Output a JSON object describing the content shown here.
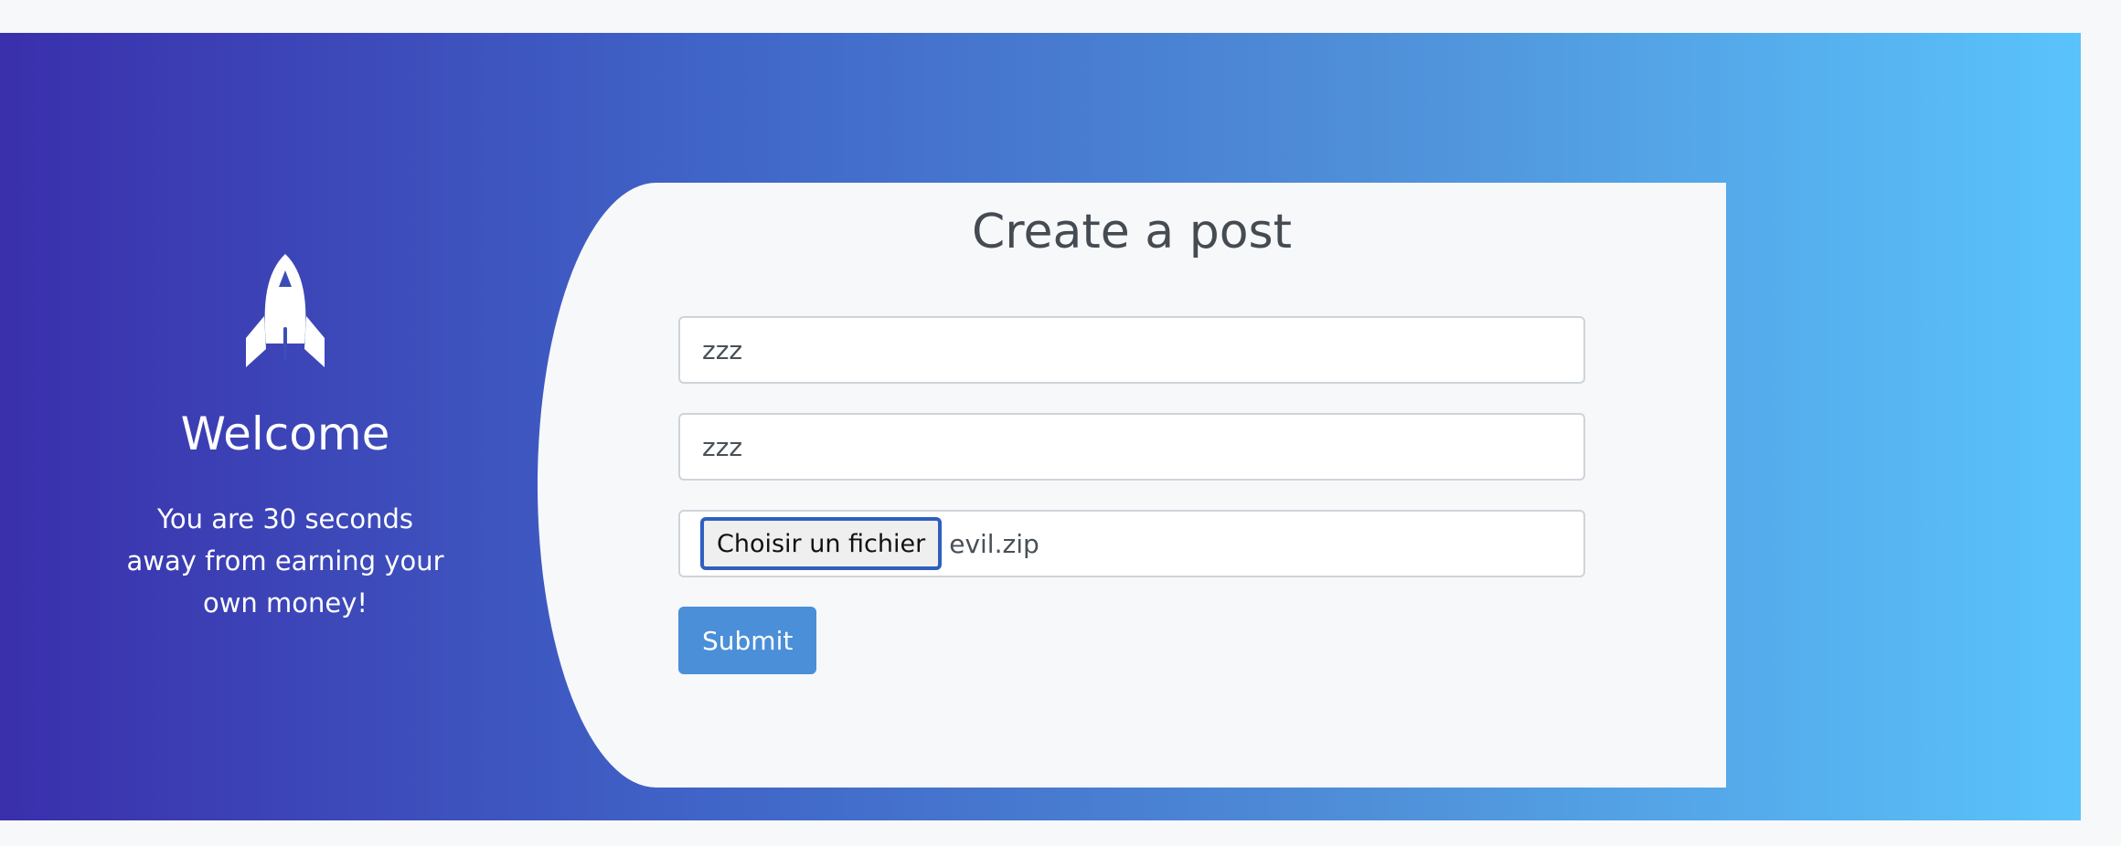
{
  "hero": {
    "icon": "rocket-icon",
    "title": "Welcome",
    "subtitle": "You are 30 seconds away from earning your own money!"
  },
  "form": {
    "heading": "Create a post",
    "title_value": "zzz",
    "body_value": "zzz",
    "file_button_label": "Choisir un fichier",
    "file_name": "evil.zip",
    "submit_label": "Submit"
  },
  "colors": {
    "gradient_start": "#3a2fac",
    "gradient_end": "#5ac3fb",
    "submit": "#4a8fd8",
    "card": "#f7f8fa"
  }
}
